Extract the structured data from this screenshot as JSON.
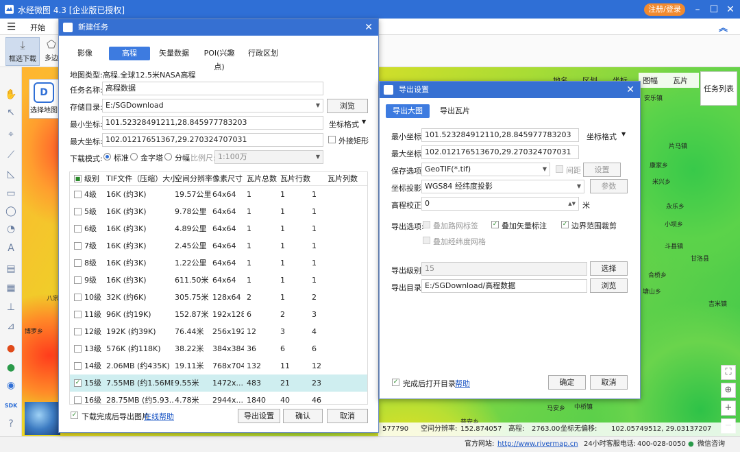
{
  "app": {
    "title": "水经微图 4.3 [企业版已授权]",
    "register_login": "注册/登录",
    "menu_start": "开始"
  },
  "toolbar": {
    "select_download": "框选下载",
    "multi_edge": "多边"
  },
  "map": {
    "select_map": "选择地图",
    "layer_tabs": [
      "地名",
      "区划",
      "坐标",
      "图幅",
      "瓦片"
    ],
    "task_list": "任务列表",
    "place_labels": [
      "安乐镇",
      "片马镇",
      "康家乡",
      "米兴乡",
      "永乐乡",
      "小坝乡",
      "斗县镇",
      "甘洛县",
      "合桥乡",
      "塘山乡",
      "吉米镇",
      "八宗乡",
      "博罗乡",
      "马安乡",
      "中桥镇",
      "普安乡"
    ],
    "coords": {
      "x_value": "577790",
      "resolution_label": "空间分辨率:",
      "resolution_value": "152.874057",
      "elevation_label": "高程:",
      "elevation_value": "2763.00",
      "coord_label": "坐标无偏移:",
      "coord_value": "102.05749512, 29.03137207"
    }
  },
  "status": {
    "website_label": "官方网站:",
    "website_url": "http://www.rivermap.cn",
    "hotline_label": "24小时客服电话:",
    "hotline": "400-028-0050",
    "wechat": "微信咨询"
  },
  "new_task": {
    "title": "新建任务",
    "tabs": [
      "影像",
      "高程",
      "矢量数据",
      "POI(兴趣点)",
      "行政区划"
    ],
    "active_tab": 1,
    "map_type_label": "地图类型:",
    "map_type_value": "高程.全球12.5米NASA高程",
    "task_name_label": "任务名称:",
    "task_name_value": "高程数据",
    "save_dir_label": "存储目录:",
    "save_dir_value": "E:/SGDownload",
    "browse": "浏览",
    "min_coord_label": "最小坐标:",
    "min_coord_value": "101.52328491211,28.845977783203",
    "coord_format": "坐标格式",
    "max_coord_label": "最大坐标:",
    "max_coord_value": "102.01217651367,29.270324707031",
    "outer_rect": "外接矩形",
    "download_mode_label": "下载模式:",
    "mode_standard": "标准",
    "mode_pyramid": "金字塔",
    "mode_tile": "分幅",
    "scale_label": "比例尺:",
    "scale_value": "1:100万",
    "table_headers": [
      "级别",
      "TIF文件（压缩）大小",
      "空间分辨率",
      "像素尺寸",
      "瓦片总数",
      "瓦片行数",
      "瓦片列数"
    ],
    "levels": [
      {
        "level": "4级",
        "size": "16K (约3K)",
        "res": "19.57公里",
        "pixels": "64x64",
        "total": "1",
        "rows": "1",
        "cols": "1",
        "checked": false
      },
      {
        "level": "5级",
        "size": "16K (约3K)",
        "res": "9.78公里",
        "pixels": "64x64",
        "total": "1",
        "rows": "1",
        "cols": "1",
        "checked": false
      },
      {
        "level": "6级",
        "size": "16K (约3K)",
        "res": "4.89公里",
        "pixels": "64x64",
        "total": "1",
        "rows": "1",
        "cols": "1",
        "checked": false
      },
      {
        "level": "7级",
        "size": "16K (约3K)",
        "res": "2.45公里",
        "pixels": "64x64",
        "total": "1",
        "rows": "1",
        "cols": "1",
        "checked": false
      },
      {
        "level": "8级",
        "size": "16K (约3K)",
        "res": "1.22公里",
        "pixels": "64x64",
        "total": "1",
        "rows": "1",
        "cols": "1",
        "checked": false
      },
      {
        "level": "9级",
        "size": "16K (约3K)",
        "res": "611.50米",
        "pixels": "64x64",
        "total": "1",
        "rows": "1",
        "cols": "1",
        "checked": false
      },
      {
        "level": "10级",
        "size": "32K (约6K)",
        "res": "305.75米",
        "pixels": "128x64",
        "total": "2",
        "rows": "1",
        "cols": "2",
        "checked": false
      },
      {
        "level": "11级",
        "size": "96K (约19K)",
        "res": "152.87米",
        "pixels": "192x128",
        "total": "6",
        "rows": "2",
        "cols": "3",
        "checked": false
      },
      {
        "level": "12级",
        "size": "192K (约39K)",
        "res": "76.44米",
        "pixels": "256x192",
        "total": "12",
        "rows": "3",
        "cols": "4",
        "checked": false
      },
      {
        "level": "13级",
        "size": "576K (约118K)",
        "res": "38.22米",
        "pixels": "384x384",
        "total": "36",
        "rows": "6",
        "cols": "6",
        "checked": false
      },
      {
        "level": "14级",
        "size": "2.06MB (约435K)",
        "res": "19.11米",
        "pixels": "768x704",
        "total": "132",
        "rows": "11",
        "cols": "12",
        "checked": false
      },
      {
        "level": "15级",
        "size": "7.55MB (约1.56MB)",
        "res": "9.55米",
        "pixels": "1472x...",
        "total": "483",
        "rows": "21",
        "cols": "23",
        "checked": true
      },
      {
        "level": "16级",
        "size": "28.75MB (约5.93...",
        "res": "4.78米",
        "pixels": "2944x...",
        "total": "1840",
        "rows": "40",
        "cols": "46",
        "checked": false
      }
    ],
    "export_after": "下载完成后导出图片",
    "online_help": "在线帮助",
    "export_settings": "导出设置",
    "ok": "确认",
    "cancel": "取消"
  },
  "export": {
    "title": "导出设置",
    "tabs": [
      "导出大图",
      "导出瓦片"
    ],
    "min_coord_label": "最小坐标:",
    "min_coord_value": "101.523284912110,28.845977783203",
    "coord_format": "坐标格式",
    "max_coord_label": "最大坐标:",
    "max_coord_value": "102.012176513670,29.270324707031",
    "save_option_label": "保存选项:",
    "save_option_value": "GeoTIF(*.tif)",
    "spacing": "间距",
    "settings": "设置",
    "projection_label": "坐标投影:",
    "projection_value": "WGS84 经纬度投影",
    "params": "参数",
    "elev_corr_label": "高程校正:",
    "elev_corr_value": "0",
    "elev_unit": "米",
    "export_opts_label": "导出选项:",
    "opt_road": "叠加路网标签",
    "opt_vector": "叠加矢量标注",
    "opt_boundary": "边界范围裁剪",
    "opt_grid": "叠加经纬度网格",
    "level_label": "导出级别:",
    "level_value": "15",
    "select": "选择",
    "dir_label": "导出目录:",
    "dir_value": "E:/SGDownload/高程数据",
    "browse": "浏览",
    "open_after": "完成后打开目录",
    "help": "帮助",
    "ok": "确定",
    "cancel": "取消"
  }
}
